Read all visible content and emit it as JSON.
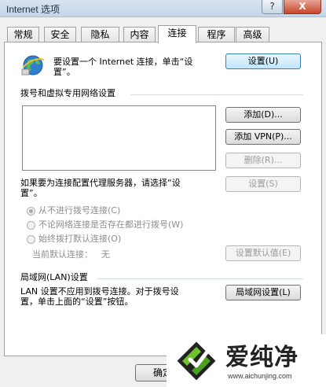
{
  "window": {
    "title": "Internet 选项",
    "help_label": "?",
    "close_label": "X"
  },
  "tabs": [
    {
      "label": "常规"
    },
    {
      "label": "安全"
    },
    {
      "label": "隐私"
    },
    {
      "label": "内容"
    },
    {
      "label": "连接",
      "active": true
    },
    {
      "label": "程序"
    },
    {
      "label": "高级"
    }
  ],
  "setup": {
    "description_line1": "要设置一个 Internet 连接，单击“设",
    "description_line2": "置”。",
    "button_label": "设置(U)"
  },
  "dialup": {
    "group_label": "拨号和虚拟专用网络设置",
    "add_label": "添加(D)...",
    "add_vpn_label": "添加 VPN(P)...",
    "remove_label": "删除(R)...",
    "proxy_text_line1": "如果要为连接配置代理服务器，请选择“设",
    "proxy_text_line2": "置”。",
    "settings_label": "设置(S)",
    "options": [
      {
        "label": "从不进行拨号连接(C)",
        "checked": true
      },
      {
        "label": "不论网络连接是否存在都进行拨号(W)",
        "checked": false
      },
      {
        "label": "始终拨打默认连接(O)",
        "checked": false
      }
    ],
    "current_default_label": "当前默认连接：",
    "current_default_value": "无",
    "set_default_label": "设置默认值(E)"
  },
  "lan": {
    "group_label": "局域网(LAN)设置",
    "text_line1": "LAN 设置不应用到拨号连接。对于拨号设",
    "text_line2": "置，单击上面的“设置”按钮。",
    "button_label": "局域网设置(L)"
  },
  "footer": {
    "ok_label": "确定"
  },
  "watermark": {
    "brand": "爱纯净",
    "url": "www.aichunjing.com"
  }
}
